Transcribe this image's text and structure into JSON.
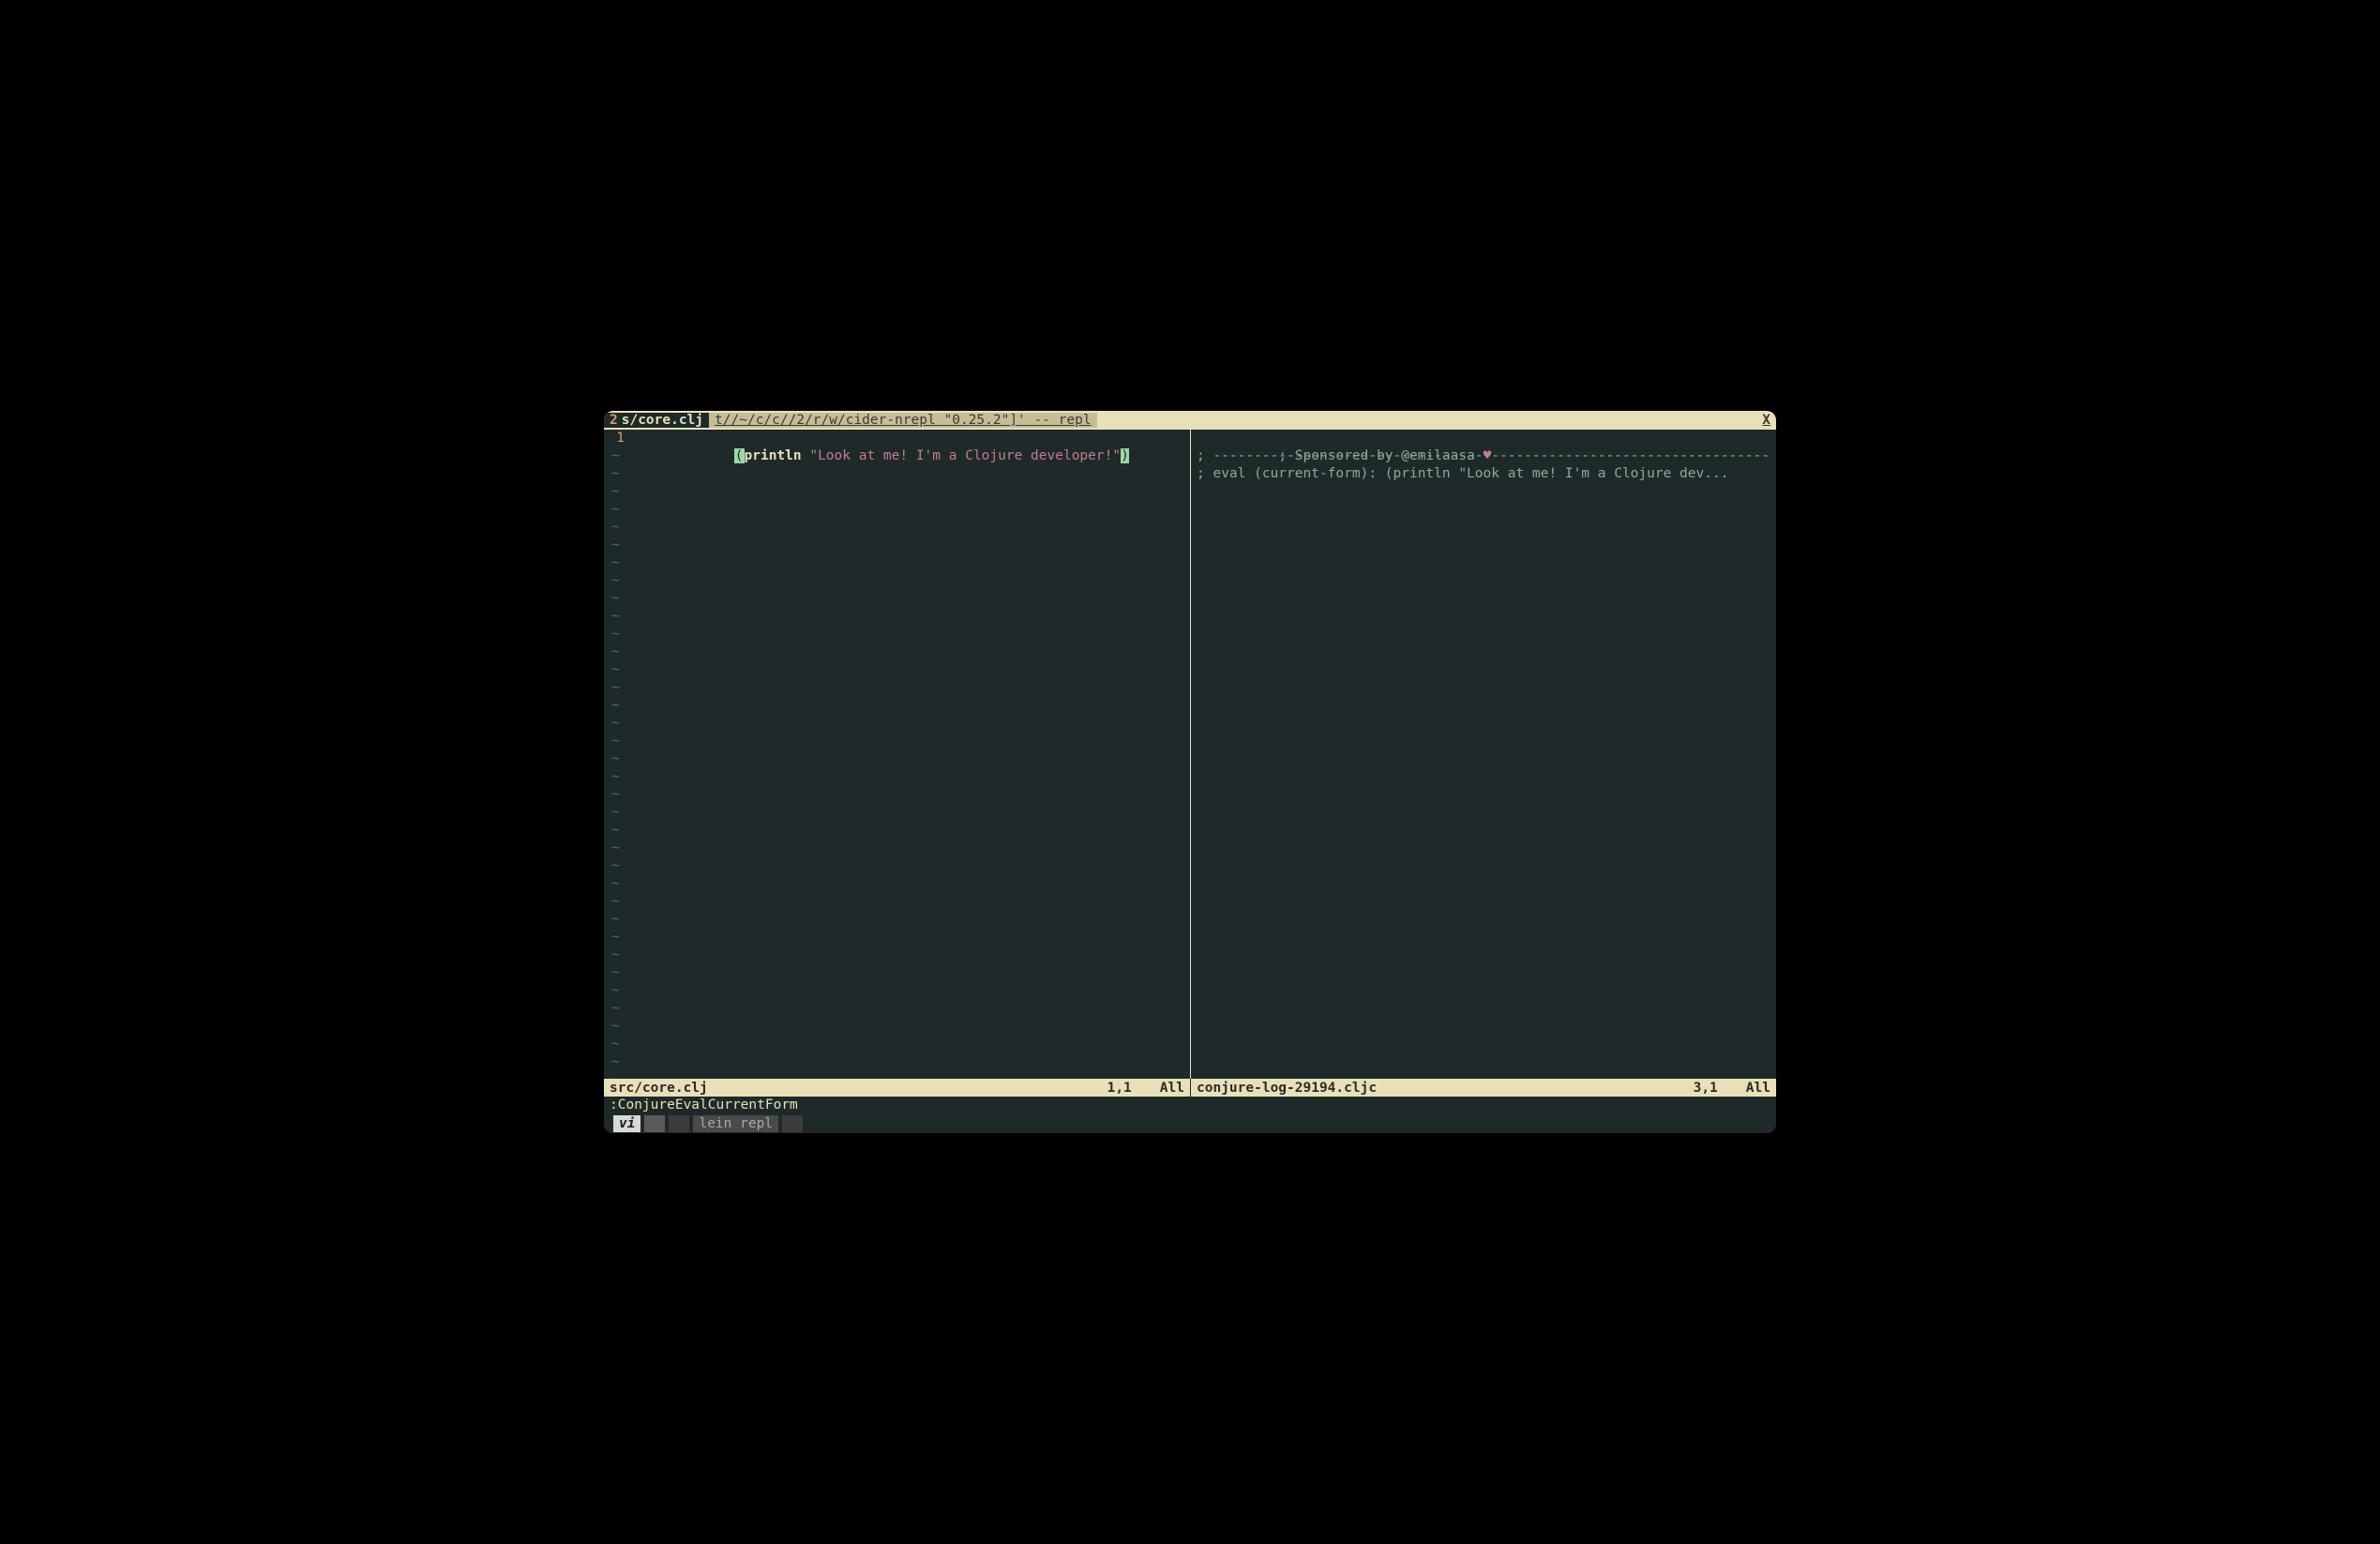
{
  "tabline": {
    "active_tab_num": "2",
    "active_tab_name": "s/core.clj",
    "inactive_tab": " t//~/c/c//2/r/w/cider-nrepl \"0.25.2\"]' -- repl ",
    "close": "X"
  },
  "editor_left": {
    "line_number": "1",
    "paren_open": "(",
    "func": "println",
    "space": " ",
    "string": "\"Look at me! I'm a Clojure developer!\"",
    "paren_close": ")",
    "tildes": 36
  },
  "editor_right": {
    "line1": "; Sponsored by @emilaasa ",
    "heart": "♥",
    "line2": "; --------------------------------------------------------------------",
    "line3": "; eval (current-form): (println \"Look at me! I'm a Clojure dev..."
  },
  "status_left": {
    "filename": "src/core.clj",
    "position": "1,1",
    "scroll": "All"
  },
  "status_right": {
    "filename": "conjure-log-29194.cljc",
    "position": "3,1",
    "scroll": "All"
  },
  "command": ":ConjureEvalCurrentForm",
  "tmux": {
    "active": "vi",
    "inactive": "lein repl"
  }
}
